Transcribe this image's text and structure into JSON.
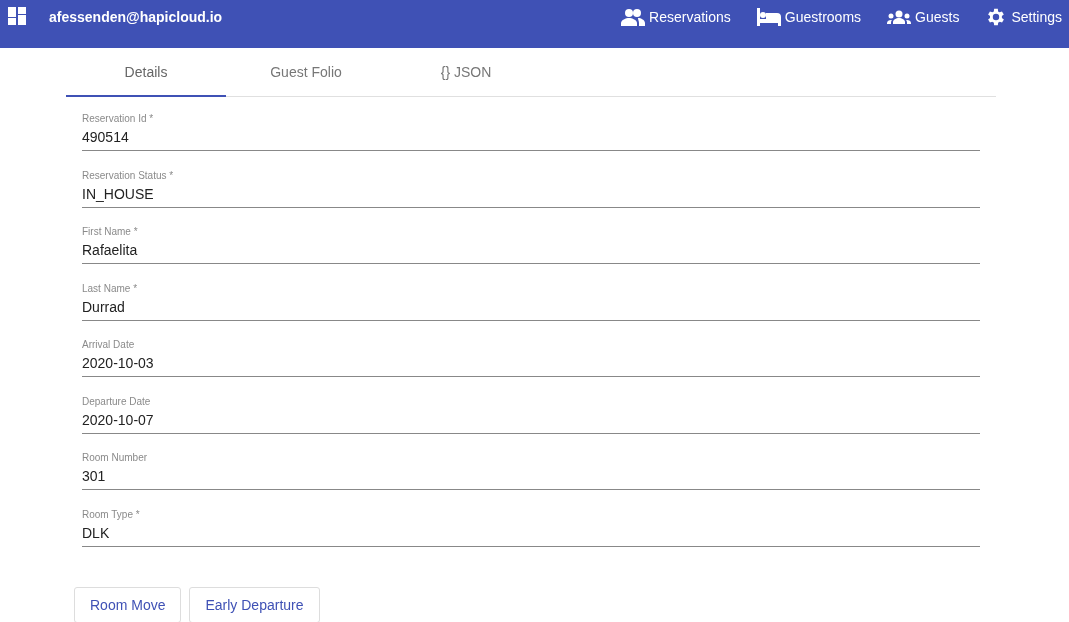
{
  "header": {
    "user": "afessenden@hapicloud.io",
    "nav": [
      {
        "kind": "people",
        "label": "Reservations"
      },
      {
        "kind": "bed",
        "label": "Guestrooms"
      },
      {
        "kind": "group",
        "label": "Guests"
      },
      {
        "kind": "gear",
        "label": "Settings"
      }
    ]
  },
  "tabs": [
    {
      "label": "Details",
      "selected": true
    },
    {
      "label": "Guest Folio",
      "selected": false
    },
    {
      "label": "{} JSON",
      "selected": false
    }
  ],
  "fields": [
    {
      "label": "Reservation Id *",
      "value": "490514"
    },
    {
      "label": "Reservation Status *",
      "value": "IN_HOUSE"
    },
    {
      "label": "First Name *",
      "value": "Rafaelita"
    },
    {
      "label": "Last Name *",
      "value": "Durrad"
    },
    {
      "label": "Arrival Date",
      "value": "2020-10-03"
    },
    {
      "label": "Departure Date",
      "value": "2020-10-07"
    },
    {
      "label": "Room Number",
      "value": "301"
    },
    {
      "label": "Room Type *",
      "value": "DLK"
    }
  ],
  "buttons": [
    "Room Move",
    "Early Departure"
  ]
}
